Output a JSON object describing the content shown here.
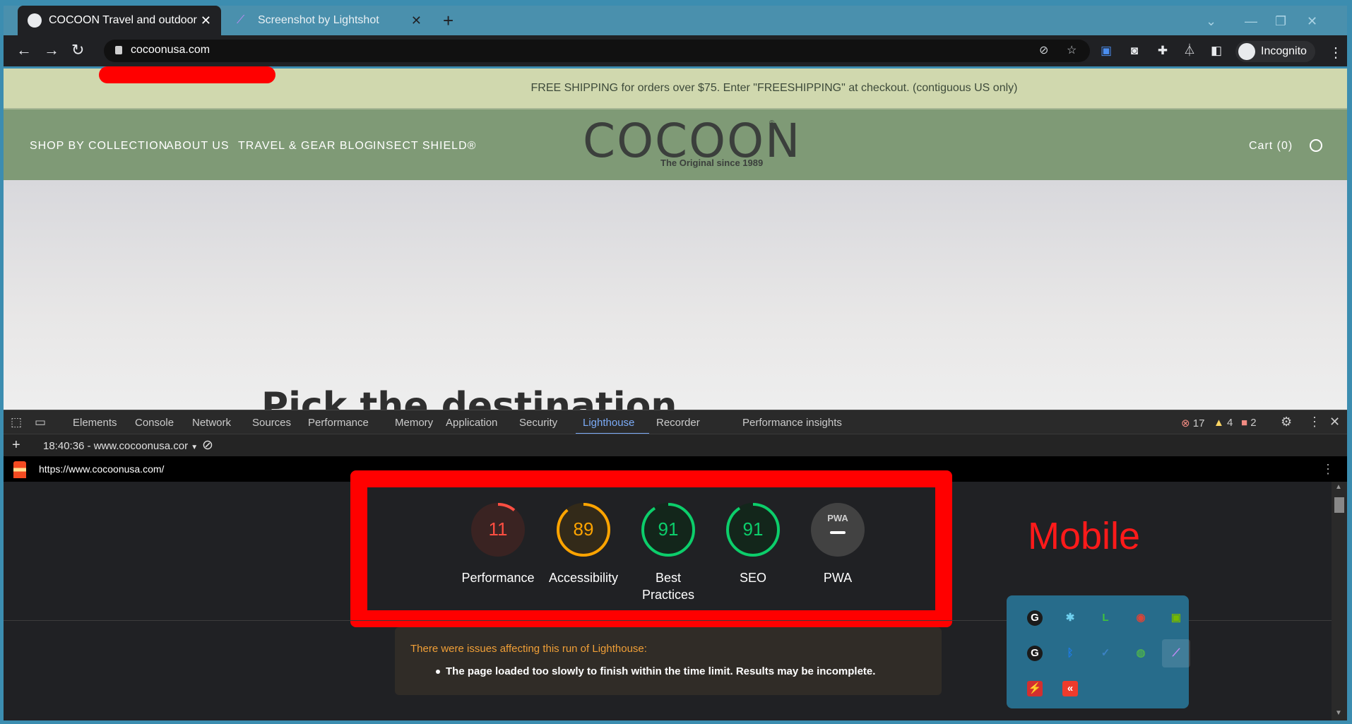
{
  "browser": {
    "tabs": [
      {
        "title": "COCOON Travel and outdoor ac",
        "active": true
      },
      {
        "title": "Screenshot by Lightshot",
        "active": false
      }
    ],
    "new_tab_label": "+",
    "url": "cocoonusa.com",
    "incognito_label": "Incognito",
    "icons": [
      "back-icon",
      "forward-icon",
      "reload-icon",
      "lock-icon",
      "eye-off-icon",
      "star-icon",
      "extensions-icon",
      "lab-icon",
      "sidebar-icon",
      "kebab-icon"
    ]
  },
  "site": {
    "promo": "FREE SHIPPING for orders over $75. Enter \"FREESHIPPING\" at checkout. (contiguous US only)",
    "nav": [
      "SHOP BY COLLECTION",
      "ABOUT US",
      "TRAVEL & GEAR BLOG",
      "INSECT SHIELD®"
    ],
    "logo": "COCOON",
    "logo_reg": "®",
    "tagline": "The Original since 1989",
    "cart": "Cart (0)",
    "hero_title": "Pick the destination"
  },
  "devtools": {
    "tabs": [
      "Elements",
      "Console",
      "Network",
      "Sources",
      "Performance",
      "Memory",
      "Application",
      "Security",
      "Lighthouse",
      "Recorder",
      "Performance insights"
    ],
    "selected_tab": "Lighthouse",
    "errors": "17",
    "warnings": "4",
    "issues": "2",
    "report_select": "18:40:36 - www.cocoonusa.cor",
    "report_url": "https://www.cocoonusa.com/"
  },
  "lighthouse": {
    "scores": [
      {
        "label": "Performance",
        "score": "11",
        "value": 11,
        "color": "#ff4e42",
        "bg": "#3a2322"
      },
      {
        "label": "Accessibility",
        "score": "89",
        "value": 89,
        "color": "#ffa400",
        "bg": "#332a19"
      },
      {
        "label": "Best Practices",
        "score": "91",
        "value": 91,
        "color": "#0cce6b",
        "bg": "#13261b"
      },
      {
        "label": "SEO",
        "score": "91",
        "value": 91,
        "color": "#0cce6b",
        "bg": "#13261b"
      },
      {
        "label": "PWA",
        "score": "PWA",
        "value": null,
        "color": "#9e9e9e",
        "bg": "#424242"
      }
    ],
    "annotation": "Mobile",
    "warning_heading": "There were issues affecting this run of Lighthouse:",
    "warning_item": "The page loaded too slowly to finish within the time limit. Results may be incomplete."
  },
  "tray": {
    "icons": [
      "grammarly-icon",
      "app-icon",
      "line-icon",
      "chrome-dev-icon",
      "nvidia-icon",
      "grammarly-alt-icon",
      "bluetooth-icon",
      "defender-icon",
      "network-globe-icon",
      "lightshot-icon",
      "red-app-icon",
      "anydesk-icon"
    ]
  }
}
